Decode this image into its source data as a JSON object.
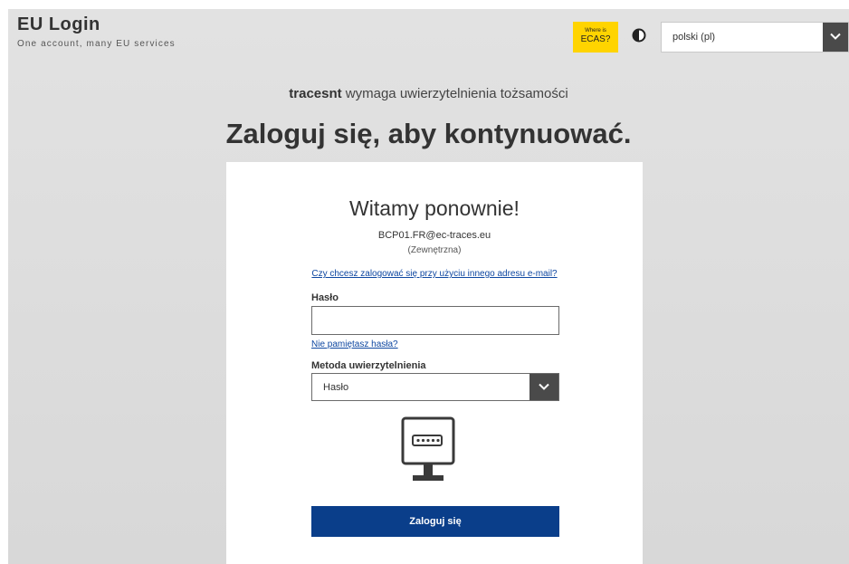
{
  "header": {
    "title": "EU Login",
    "subtitle": "One account, many EU services",
    "ecas_line1": "Where is",
    "ecas_line2": "ECAS?",
    "language": "polski (pl)"
  },
  "auth": {
    "service": "tracesnt",
    "message": " wymaga uwierzytelnienia tożsamości",
    "heading": "Zaloguj się, aby kontynuować."
  },
  "card": {
    "welcome": "Witamy ponownie!",
    "email": "BCP01.FR@ec-traces.eu",
    "account_type": "(Zewnętrzna)",
    "alt_email_link": "Czy chcesz zalogować się przy użyciu innego adresu e-mail?",
    "password_label": "Hasło",
    "password_value": "",
    "forgot_link": "Nie pamiętasz hasła?",
    "method_label": "Metoda uwierzytelnienia",
    "method_value": "Hasło",
    "login_button": "Zaloguj się"
  },
  "colors": {
    "accent": "#0a3e8a",
    "ecas_badge": "#ffd400",
    "link": "#0e47a1"
  },
  "icons": [
    "contrast-icon",
    "chevron-down-icon",
    "password-screen-icon"
  ]
}
